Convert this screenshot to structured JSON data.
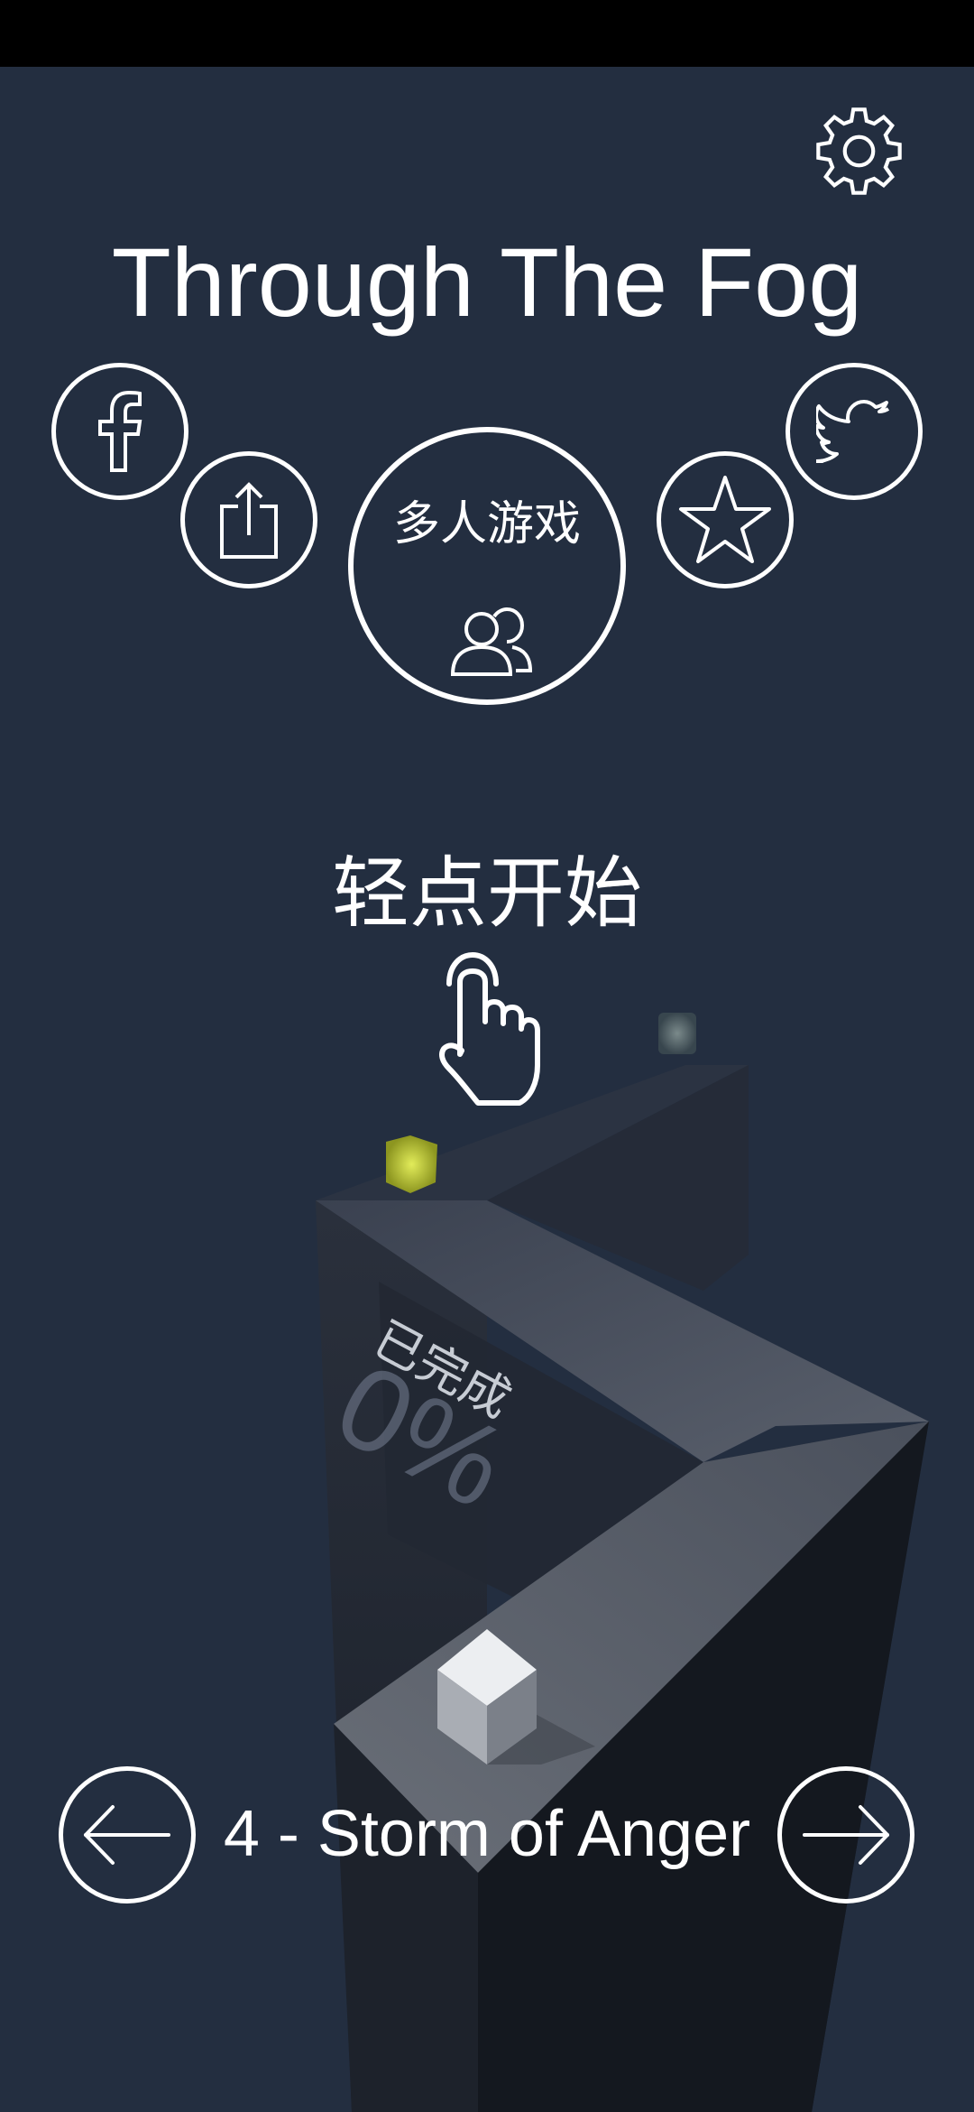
{
  "game": {
    "title": "Through The Fog",
    "multiplayer_label": "多人游戏",
    "tap_to_start": "轻点开始",
    "completed_label": "已完成",
    "completed_percent": "0%",
    "level_name": "4 - Storm of Anger"
  },
  "icons": {
    "settings": "gear-icon",
    "facebook": "facebook-icon",
    "share": "share-icon",
    "rate": "star-icon",
    "twitter": "twitter-icon",
    "multiplayer": "users-icon",
    "tap_hint": "pointing-hand-icon",
    "prev_level": "arrow-left-icon",
    "next_level": "arrow-right-icon"
  },
  "colors": {
    "background": "#232e40",
    "status_bar": "#000000",
    "foreground": "#ffffff",
    "player_cube": "#d8dbe0",
    "gem": "#b9c43a"
  }
}
